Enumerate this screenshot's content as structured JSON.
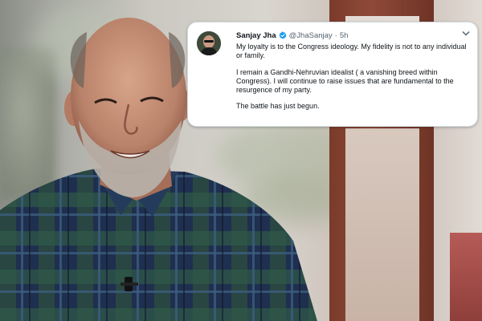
{
  "tweet": {
    "display_name": "Sanjay Jha",
    "handle": "@JhaSanjay",
    "separator": "·",
    "time": "5h",
    "paragraphs": [
      "My loyalty is to the Congress ideology. My fidelity is not to any individual or family.",
      "I remain a Gandhi-Nehruvian idealist ( a vanishing breed within Congress). I will continue to raise issues that are fundamental to the resurgence of my party.",
      "The battle has just begun."
    ],
    "icons": {
      "verified": "verified-badge-icon",
      "menu": "chevron-down-icon"
    },
    "colors": {
      "verified": "#1d9bf0",
      "text": "#0f1419",
      "muted": "#536471"
    }
  }
}
